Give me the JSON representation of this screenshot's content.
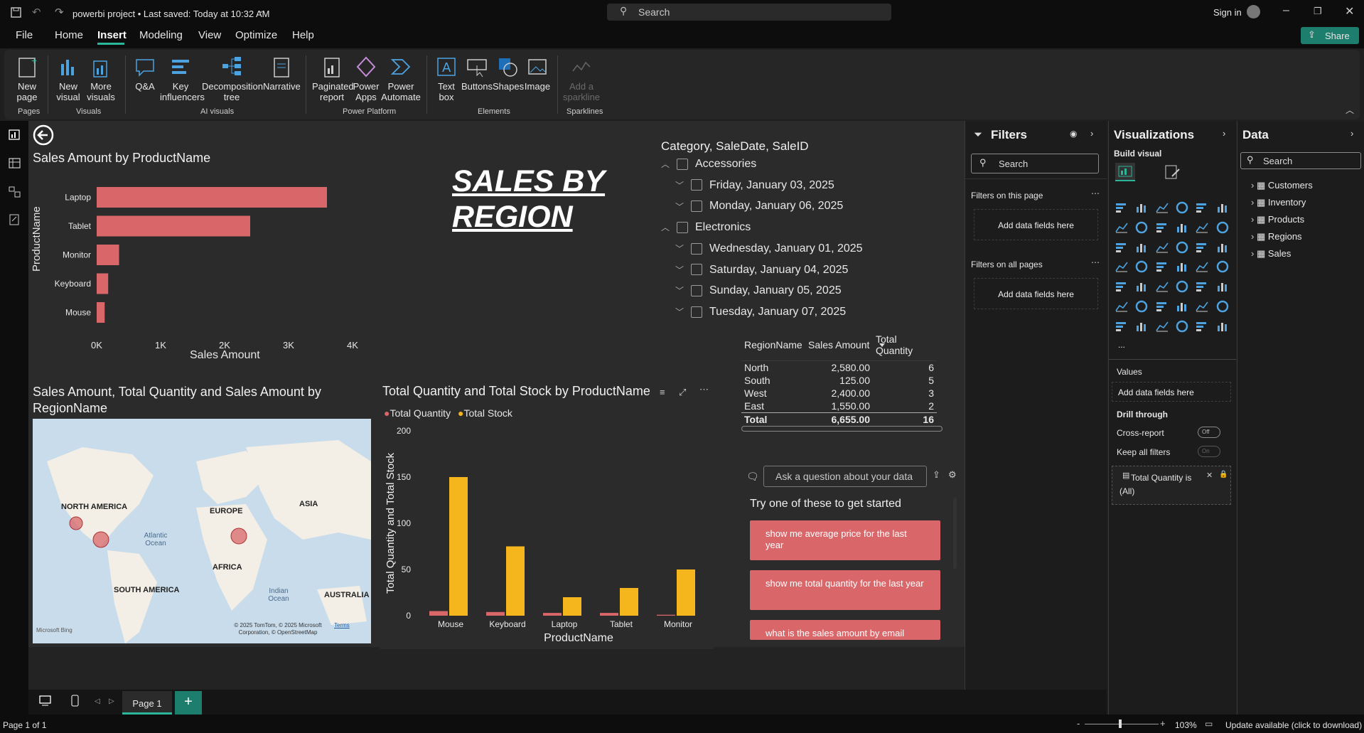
{
  "titlebar": {
    "title": "powerbi project • Last saved: Today at 10:32 AM",
    "search_placeholder": "Search",
    "sign_in": "Sign in"
  },
  "menu": [
    "File",
    "Home",
    "Insert",
    "Modeling",
    "View",
    "Optimize",
    "Help"
  ],
  "share_label": "Share",
  "ribbon": {
    "new_page": "New page",
    "new_visual": "New visual",
    "more_visuals": "More visuals",
    "qa": "Q&A",
    "key_influencers": "Key influencers",
    "decomposition_tree": "Decomposition tree",
    "narrative": "Narrative",
    "paginated_report": "Paginated report",
    "power_apps": "Power Apps",
    "power_automate": "Power Automate",
    "text_box": "Text box",
    "buttons": "Buttons",
    "shapes": "Shapes",
    "image": "Image",
    "add_sparkline": "Add a sparkline",
    "groups": {
      "pages": "Pages",
      "visuals": "Visuals",
      "ai_visuals": "AI visuals",
      "power_platform": "Power Platform",
      "elements": "Elements",
      "sparklines": "Sparklines"
    }
  },
  "bar_chart": {
    "title": "Sales Amount by ProductName",
    "ylabel": "ProductName",
    "xlabel": "Sales Amount",
    "ticks": [
      "0K",
      "1K",
      "2K",
      "3K",
      "4K"
    ]
  },
  "sales_title": "SALES BY REGION",
  "slicer": {
    "header": "Category, SaleDate, SaleID",
    "rows": [
      {
        "label": "Accessories",
        "level": 0
      },
      {
        "label": "Friday, January 03, 2025",
        "level": 1
      },
      {
        "label": "Monday, January 06, 2025",
        "level": 1
      },
      {
        "label": "Electronics",
        "level": 0
      },
      {
        "label": "Wednesday, January 01, 2025",
        "level": 1
      },
      {
        "label": "Saturday, January 04, 2025",
        "level": 1
      },
      {
        "label": "Sunday, January 05, 2025",
        "level": 1
      },
      {
        "label": "Tuesday, January 07, 2025",
        "level": 1
      }
    ]
  },
  "region_table": {
    "headers": [
      "RegionName",
      "Sales Amount",
      "Total Quantity"
    ],
    "rows": [
      [
        "North",
        "2,580.00",
        "6"
      ],
      [
        "South",
        "125.00",
        "5"
      ],
      [
        "West",
        "2,400.00",
        "3"
      ],
      [
        "East",
        "1,550.00",
        "2"
      ]
    ],
    "total": [
      "Total",
      "6,655.00",
      "16"
    ]
  },
  "map": {
    "title": "Sales Amount, Total Quantity and Sales Amount by RegionName",
    "labels": {
      "north_america": "NORTH AMERICA",
      "europe": "EUROPE",
      "asia": "ASIA",
      "africa": "AFRICA",
      "south_america": "SOUTH AMERICA",
      "australia": "AUSTRALIA",
      "atlantic": "Atlantic Ocean",
      "indian": "Indian Ocean"
    },
    "copyright": "© 2025 TomTom, © 2025 Microsoft Corporation, © OpenStreetMap",
    "terms": "Terms",
    "bing": "Microsoft Bing"
  },
  "col_chart_title": "Total Quantity and Total Stock by ProductName",
  "chart_data": {
    "type": "bar",
    "categories": [
      "Mouse",
      "Keyboard",
      "Laptop",
      "Tablet",
      "Monitor"
    ],
    "series": [
      {
        "name": "Total Quantity",
        "color": "#d9676a",
        "values": [
          5,
          4,
          3,
          3,
          1
        ]
      },
      {
        "name": "Total Stock",
        "color": "#f5b51d",
        "values": [
          150,
          75,
          20,
          30,
          50
        ]
      }
    ],
    "xlabel": "ProductName",
    "ylabel": "Total Quantity and Total Stock",
    "ylim": [
      0,
      200
    ],
    "yticks": [
      "0",
      "50",
      "100",
      "150",
      "200"
    ]
  },
  "bar_chart_data": {
    "type": "bar",
    "categories": [
      "Laptop",
      "Tablet",
      "Monitor",
      "Keyboard",
      "Mouse"
    ],
    "values": [
      3600,
      2400,
      350,
      180,
      125
    ],
    "xlim": [
      0,
      4000
    ]
  },
  "qa": {
    "placeholder": "Ask a question about your data",
    "prompt": "Try one of these to get started",
    "suggestions": [
      "show me average price for the last year",
      "show me total quantity for the last year",
      "what is the sales amount by email"
    ]
  },
  "filters": {
    "title": "Filters",
    "search": "Search",
    "on_this_page": "Filters on this page",
    "on_all_pages": "Filters on all pages",
    "add_fields": "Add data fields here"
  },
  "visualizations": {
    "title": "Visualizations",
    "build": "Build visual",
    "values": "Values",
    "add_fields": "Add data fields here",
    "drill_through": "Drill through",
    "cross_report": "Cross-report",
    "cross_report_state": "Off",
    "keep_all_filters": "Keep all filters",
    "keep_state": "On",
    "filter_card": "Total Quantity is (All)",
    "more": "..."
  },
  "data": {
    "title": "Data",
    "search": "Search",
    "tables": [
      "Customers",
      "Inventory",
      "Products",
      "Regions",
      "Sales"
    ]
  },
  "pages": {
    "tab": "Page 1",
    "status": "Page 1 of 1"
  },
  "status": {
    "zoom": "103%",
    "update": "Update available (click to download)"
  }
}
